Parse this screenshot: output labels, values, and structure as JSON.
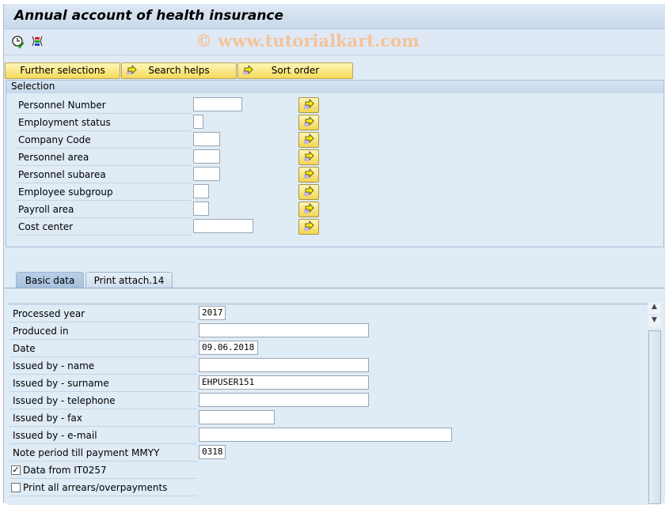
{
  "title": "Annual account of health insurance",
  "watermark": "© www.tutorialkart.com",
  "toolbar": {
    "icons": [
      "execute-clock-icon",
      "selection-options-icon"
    ]
  },
  "buttons": {
    "further": "Further selections",
    "search": "Search helps",
    "sort": "Sort order"
  },
  "selection": {
    "header": "Selection",
    "rows": [
      {
        "label": "Personnel Number",
        "value": ""
      },
      {
        "label": "Employment status",
        "value": ""
      },
      {
        "label": "Company Code",
        "value": ""
      },
      {
        "label": "Personnel area",
        "value": ""
      },
      {
        "label": "Personnel subarea",
        "value": ""
      },
      {
        "label": "Employee subgroup",
        "value": ""
      },
      {
        "label": "Payroll area",
        "value": ""
      },
      {
        "label": "Cost center",
        "value": ""
      }
    ]
  },
  "tabs": [
    {
      "label": "Basic data",
      "active": true
    },
    {
      "label": "Print attach.14",
      "active": false
    }
  ],
  "basic": {
    "rows": [
      {
        "label": "Processed year",
        "value": "2017"
      },
      {
        "label": "Produced in",
        "value": ""
      },
      {
        "label": "Date",
        "value": "09.06.2018"
      },
      {
        "label": "Issued by - name",
        "value": ""
      },
      {
        "label": "Issued by - surname",
        "value": "EHPUSER151"
      },
      {
        "label": "Issued by - telephone",
        "value": ""
      },
      {
        "label": "Issued by - fax",
        "value": ""
      },
      {
        "label": "Issued by - e-mail",
        "value": ""
      },
      {
        "label": "Note period till payment MMYY",
        "value": "0318"
      }
    ],
    "checkboxes": [
      {
        "label": "Data from IT0257",
        "checked": true
      },
      {
        "label": "Print all arrears/overpayments",
        "checked": false
      }
    ]
  }
}
